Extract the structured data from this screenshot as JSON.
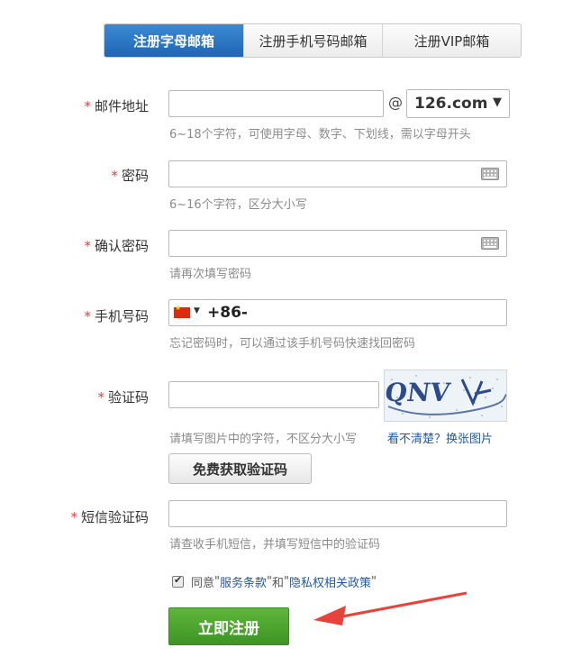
{
  "tabs": [
    {
      "label": "注册字母邮箱",
      "active": true
    },
    {
      "label": "注册手机号码邮箱",
      "active": false
    },
    {
      "label": "注册VIP邮箱",
      "active": false
    }
  ],
  "required_mark": "*",
  "email": {
    "label": "邮件地址",
    "value": "",
    "at_symbol": "@",
    "domain_selected": "126.com",
    "hint": "6~18个字符，可使用字母、数字、下划线，需以字母开头"
  },
  "password": {
    "label": "密码",
    "value": "",
    "hint": "6~16个字符，区分大小写",
    "keyboard_icon": "keyboard-icon"
  },
  "confirm_password": {
    "label": "确认密码",
    "value": "",
    "hint": "请再次填写密码",
    "keyboard_icon": "keyboard-icon"
  },
  "phone": {
    "label": "手机号码",
    "country_flag": "china-flag-icon",
    "country_code": "+86-",
    "value": "",
    "hint": "忘记密码时，可以通过该手机号码快速找回密码"
  },
  "captcha": {
    "label": "验证码",
    "value": "",
    "image_text": "QNV",
    "hint": "请填写图片中的字符，不区分大小写",
    "refresh_link": "看不清楚？换张图片",
    "get_code_button": "免费获取验证码"
  },
  "sms_code": {
    "label": "短信验证码",
    "value": "",
    "hint": "请查收手机短信，并填写短信中的验证码"
  },
  "agreement": {
    "checked": true,
    "prefix": "同意",
    "quote": "\"",
    "terms": "服务条款",
    "middle": "和",
    "privacy": "隐私权相关政策"
  },
  "submit_label": "立即注册",
  "colors": {
    "tab_active": "#1f66b6",
    "required": "#e53e3e",
    "link": "#1f5aa6",
    "submit": "#4ba22e",
    "arrow": "#e8433a"
  }
}
